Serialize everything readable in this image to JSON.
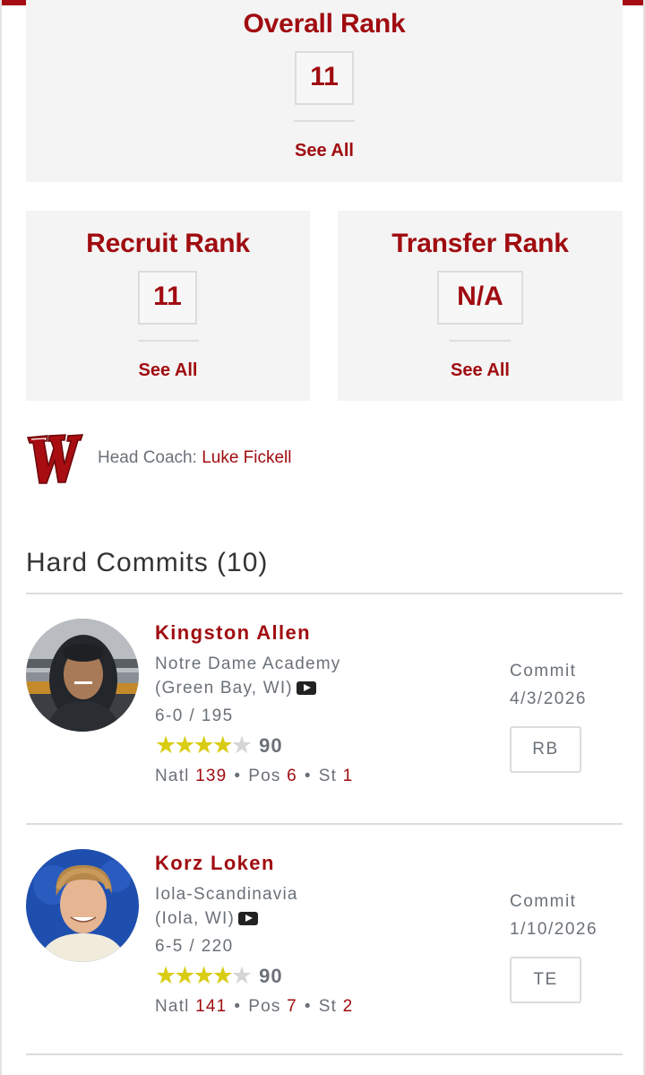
{
  "overall": {
    "title": "Overall Rank",
    "value": "11",
    "link": "See All"
  },
  "recruit": {
    "title": "Recruit Rank",
    "value": "11",
    "link": "See All"
  },
  "transfer": {
    "title": "Transfer Rank",
    "value": "N/A",
    "link": "See All"
  },
  "coach": {
    "label": "Head Coach: ",
    "name": "Luke Fickell"
  },
  "commits": {
    "title": "Hard Commits (10)",
    "players": [
      {
        "name": "Kingston Allen",
        "school": "Notre Dame Academy",
        "location": "(Green Bay, WI)",
        "height_weight": "6-0 / 195",
        "stars": 4,
        "rating": "90",
        "natl_label": "Natl",
        "natl": "139",
        "pos_label": "Pos",
        "pos_rank": "6",
        "st_label": "St",
        "st_rank": "1",
        "commit_label": "Commit",
        "commit_date": "4/3/2026",
        "position": "RB"
      },
      {
        "name": "Korz Loken",
        "school": "Iola-Scandinavia",
        "location": "(Iola, WI)",
        "height_weight": "6-5 / 220",
        "stars": 4,
        "rating": "90",
        "natl_label": "Natl",
        "natl": "141",
        "pos_label": "Pos",
        "pos_rank": "7",
        "st_label": "St",
        "st_rank": "2",
        "commit_label": "Commit",
        "commit_date": "1/10/2026",
        "position": "TE"
      }
    ]
  },
  "icons": {
    "team_logo": "wisconsin-w-logo",
    "video": "youtube-icon",
    "star": "star-icon"
  },
  "colors": {
    "accent": "#a00c10",
    "star": "#d9cc14",
    "muted": "#6b7178",
    "card_bg": "#f4f4f4"
  }
}
